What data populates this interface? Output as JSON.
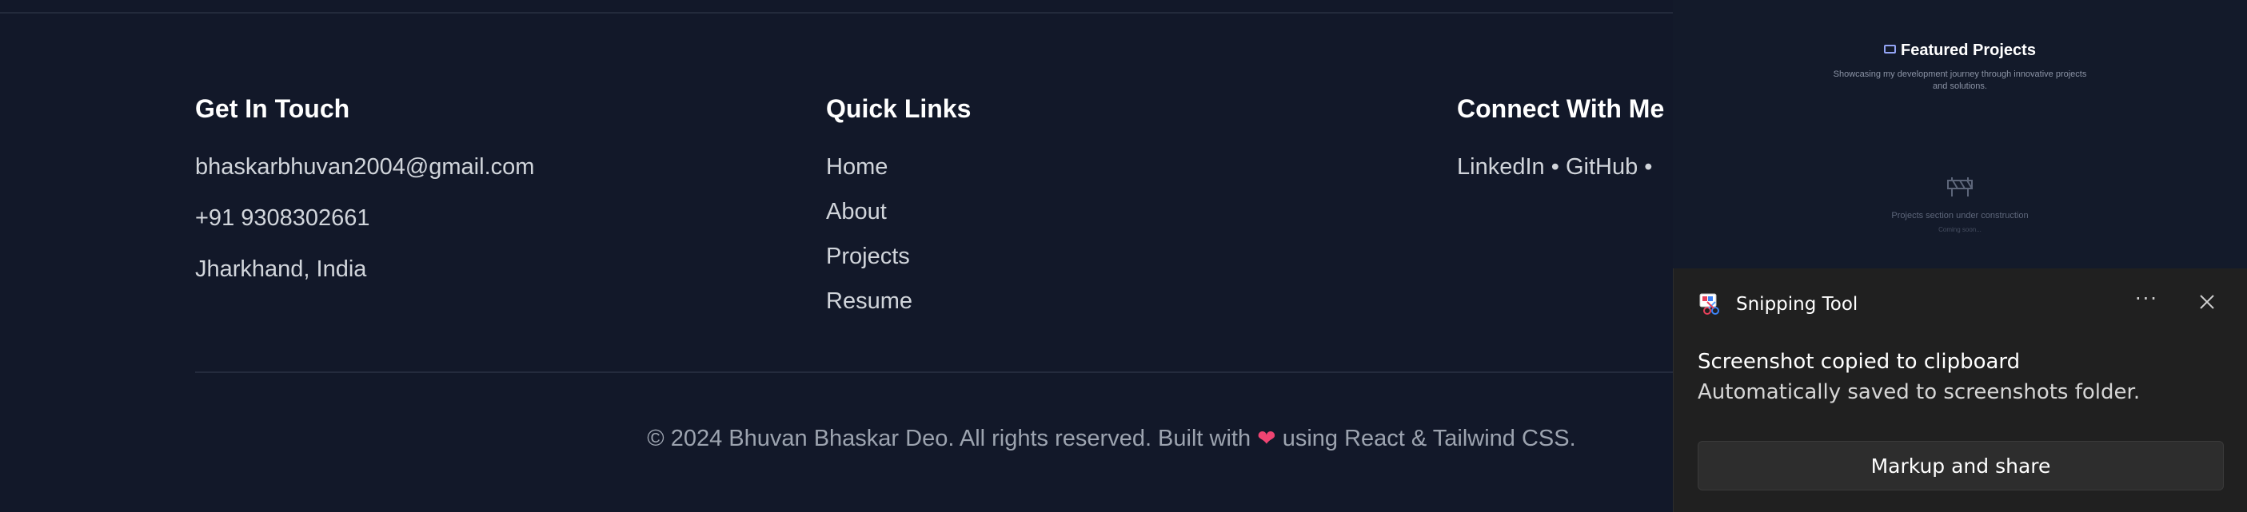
{
  "footer": {
    "contact": {
      "title": "Get In Touch",
      "email": "bhaskarbhuvan2004@gmail.com",
      "phone": "+91 9308302661",
      "location": "Jharkhand, India"
    },
    "quick_links": {
      "title": "Quick Links",
      "items": [
        "Home",
        "About",
        "Projects",
        "Resume"
      ]
    },
    "social": {
      "title": "Connect With Me",
      "links": [
        "LinkedIn",
        "GitHub"
      ],
      "separator": "•"
    },
    "copyright_prefix": "© 2024 Bhuvan Bhaskar Deo. All rights reserved. Built with",
    "heart": "❤",
    "copyright_suffix": "using React & Tailwind CSS."
  },
  "preview": {
    "title": "Featured Projects",
    "subtitle": "Showcasing my development journey through innovative projects and solutions.",
    "message": "Projects section under construction",
    "soon": "Coming soon..."
  },
  "notification": {
    "app_name": "Snipping Tool",
    "more_label": "···",
    "title": "Screenshot copied to clipboard",
    "body": "Automatically saved to screenshots folder.",
    "action_label": "Markup and share"
  },
  "colors": {
    "background": "#121829",
    "heart": "#ef4472",
    "toast_background": "#202020"
  }
}
